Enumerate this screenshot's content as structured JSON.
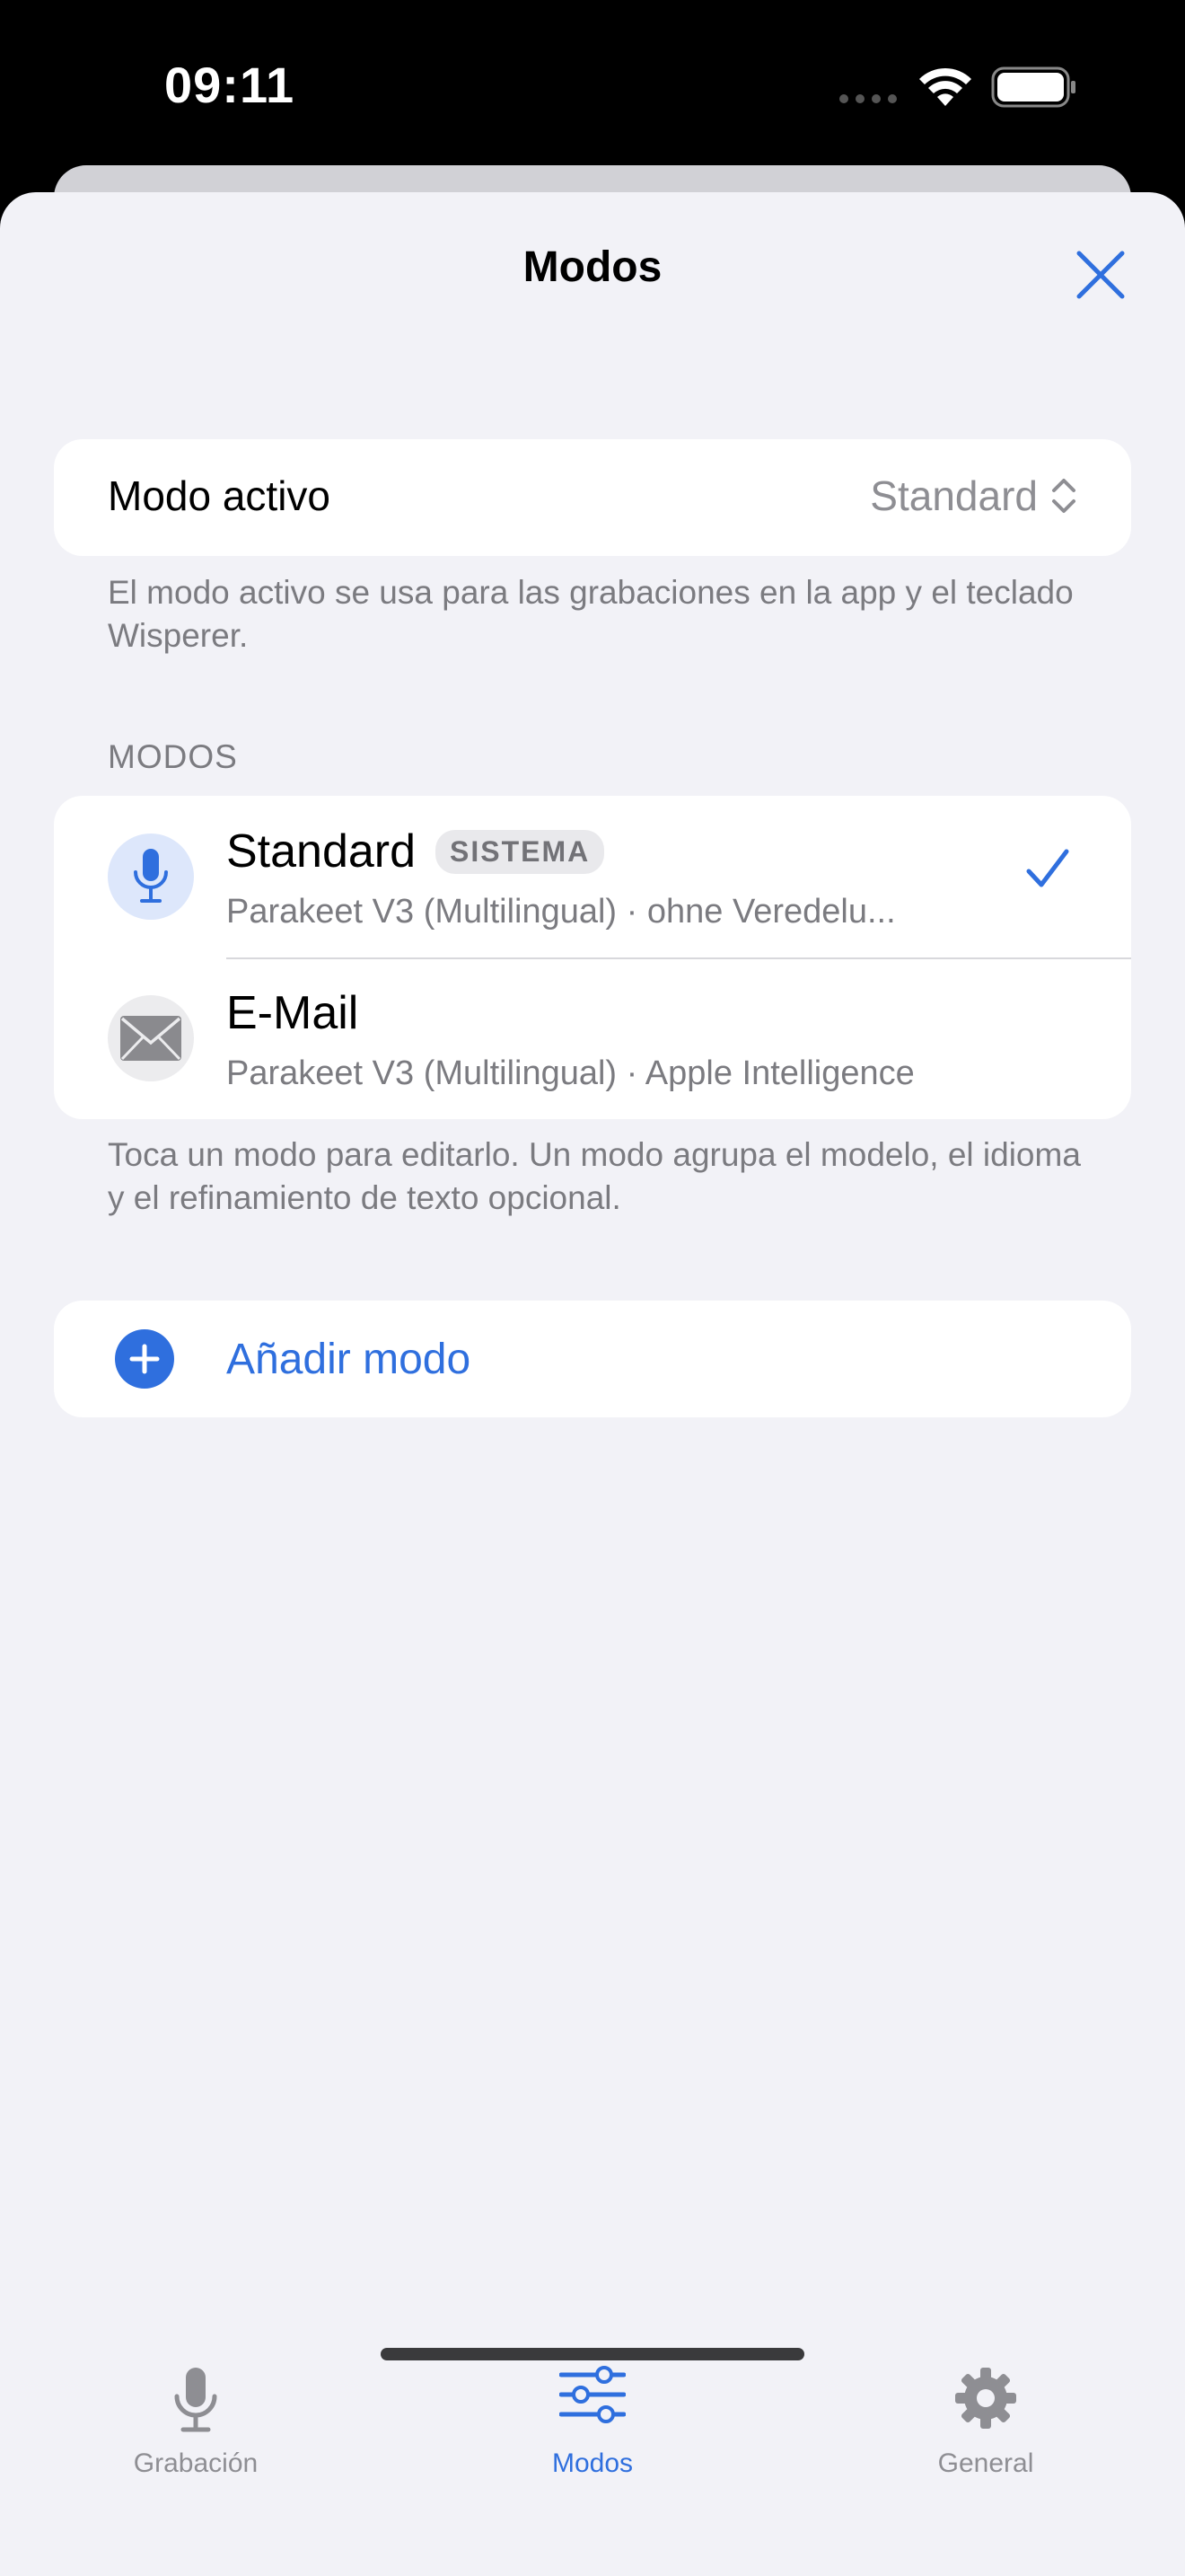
{
  "status_bar": {
    "time": "09:11"
  },
  "header": {
    "title": "Modos"
  },
  "active_mode": {
    "label": "Modo activo",
    "value": "Standard",
    "footnote": "El modo activo se usa para las grabaciones en la app y el teclado Wisperer."
  },
  "modes_section": {
    "header": "MODOS",
    "items": [
      {
        "name": "Standard",
        "badge": "SISTEMA",
        "subtitle": "Parakeet V3 (Multilingual) · ohne Veredelu...",
        "icon": "microphone-icon",
        "selected": true
      },
      {
        "name": "E-Mail",
        "badge": "",
        "subtitle": "Parakeet V3 (Multilingual) · Apple Intelligence",
        "icon": "envelope-icon",
        "selected": false
      }
    ],
    "footnote": "Toca un modo para editarlo. Un modo agrupa el modelo, el idioma y el refinamiento de texto opcional."
  },
  "add_mode": {
    "label": "Añadir modo"
  },
  "tab_bar": {
    "tabs": [
      {
        "label": "Grabación",
        "icon": "microphone-icon",
        "active": false
      },
      {
        "label": "Modos",
        "icon": "sliders-icon",
        "active": true
      },
      {
        "label": "General",
        "icon": "gear-icon",
        "active": false
      }
    ]
  },
  "colors": {
    "accent": "#2f6fde",
    "background": "#f2f2f7",
    "secondary_text": "#7b7b80"
  }
}
